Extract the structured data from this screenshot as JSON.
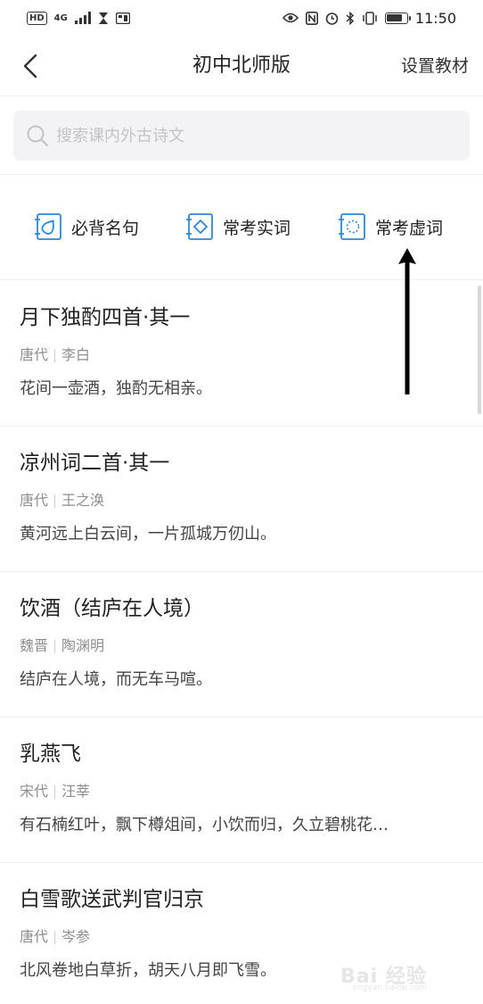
{
  "status_bar": {
    "left_hd": "HD",
    "left_net": "4G",
    "time": "11:50",
    "battery_level": 0.8
  },
  "nav": {
    "title": "初中北师版",
    "action_label": "设置教材"
  },
  "search": {
    "placeholder": "搜索课内外古诗文",
    "value": ""
  },
  "categories": [
    {
      "label": "必背名句",
      "icon": "drop-book-icon"
    },
    {
      "label": "常考实词",
      "icon": "diamond-book-icon"
    },
    {
      "label": "常考虚词",
      "icon": "dotted-circle-book-icon"
    }
  ],
  "poems": [
    {
      "title": "月下独酌四首·其一",
      "dynasty": "唐代",
      "author": "李白",
      "excerpt": "花间一壶酒，独酌无相亲。"
    },
    {
      "title": "凉州词二首·其一",
      "dynasty": "唐代",
      "author": "王之涣",
      "excerpt": "黄河远上白云间，一片孤城万仞山。"
    },
    {
      "title": "饮酒（结庐在人境）",
      "dynasty": "魏晋",
      "author": "陶渊明",
      "excerpt": "结庐在人境，而无车马喧。"
    },
    {
      "title": "乳燕飞",
      "dynasty": "宋代",
      "author": "汪莘",
      "excerpt": "有石楠红叶，飘下樽俎间，小饮而归，久立碧桃花…"
    },
    {
      "title": "白雪歌送武判官归京",
      "dynasty": "唐代",
      "author": "岑参",
      "excerpt": "北风卷地白草折，胡天八月即飞雪。"
    }
  ],
  "watermark": {
    "text": "Bai 经验",
    "sub": "jingyan.baidu.com"
  },
  "colors": {
    "accent": "#2f86d6",
    "divider": "#ededed",
    "meta": "#8e8e92"
  }
}
